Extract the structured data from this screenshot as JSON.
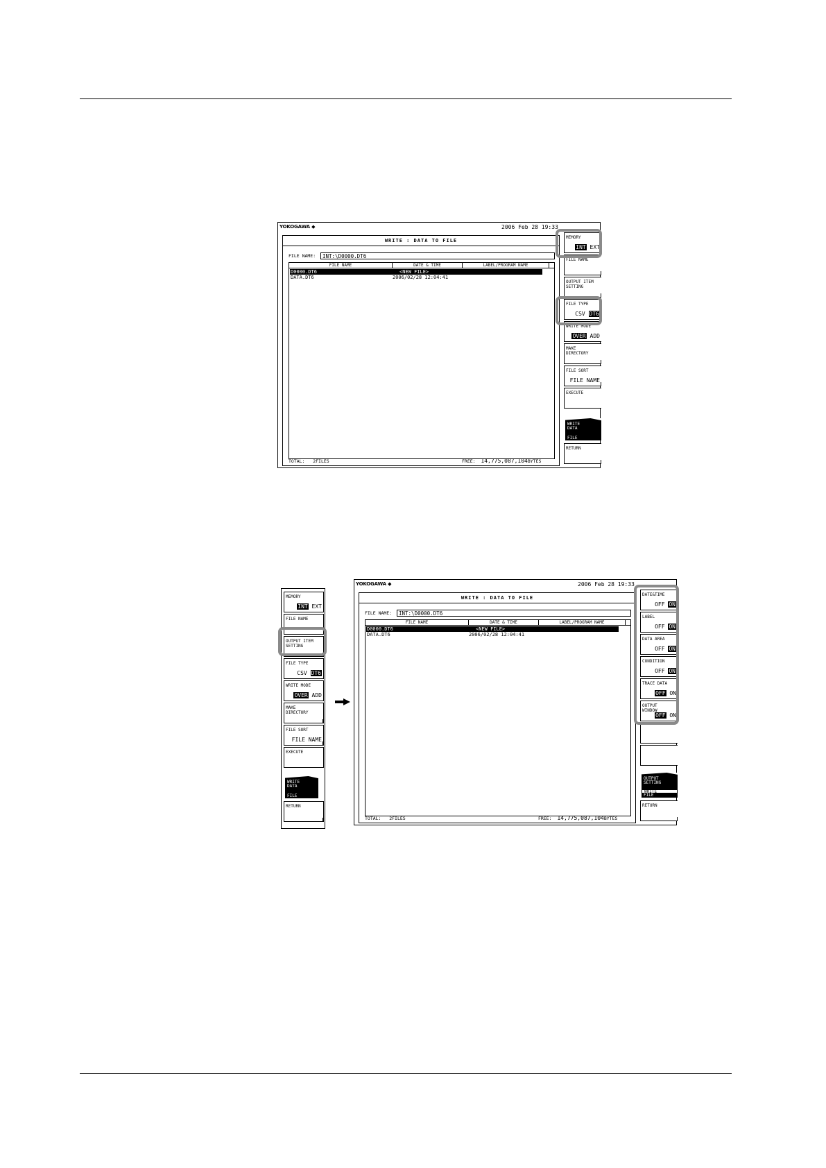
{
  "screen1": {
    "brand": "YOKOGAWA ◆",
    "datetime": "2006 Feb 28 19:33",
    "window_title": "WRITE : DATA TO FILE",
    "file_name_label": "FILE NAME",
    "file_name_value": "INT:\\D0000.DT6",
    "columns": [
      "FILE NAME",
      "DATE & TIME",
      "LABEL/PROGRAM NAME"
    ],
    "rows": [
      {
        "name": "D0000.DT6",
        "date": "<NEW FILE>",
        "selected": true
      },
      {
        "name": "DATA.DT6",
        "date": "2006/02/28 12:04:41",
        "selected": false
      }
    ],
    "total_label": "TOTAL:",
    "total_value": "2FILES",
    "free_label": "FREE:",
    "free_value": "14,775,087,104",
    "free_unit": "BYTES",
    "softkeys": {
      "memory": {
        "label": "MEMORY",
        "opt1": "INT",
        "opt2": "EXT"
      },
      "file_name": {
        "label": "FILE NAME"
      },
      "output_item": {
        "label": "OUTPUT ITEM\nSETTING"
      },
      "file_type": {
        "label": "FILE TYPE",
        "opt1": "CSV",
        "opt2": "DT6"
      },
      "write_mode": {
        "label": "WRITE MODE",
        "opt1": "OVER",
        "opt2": "ADD"
      },
      "make_dir": {
        "label": "MAKE\nDIRECTORY"
      },
      "file_sort": {
        "label": "FILE SORT",
        "value": "FILE NAME"
      },
      "execute": {
        "label": "EXECUTE"
      },
      "menu": {
        "title": "WRITE\nDATA",
        "sub": "FILE"
      },
      "return": {
        "label": "RETURN"
      }
    }
  },
  "left_menu": {
    "memory": {
      "label": "MEMORY",
      "opt1": "INT",
      "opt2": "EXT"
    },
    "file_name": {
      "label": "FILE NAME"
    },
    "output_item": {
      "label": "OUTPUT ITEM\nSETTING"
    },
    "file_type": {
      "label": "FILE TYPE",
      "opt1": "CSV",
      "opt2": "DT6"
    },
    "write_mode": {
      "label": "WRITE MODE",
      "opt1": "OVER",
      "opt2": "ADD"
    },
    "make_dir": {
      "label": "MAKE\nDIRECTORY"
    },
    "file_sort": {
      "label": "FILE SORT",
      "value": "FILE NAME"
    },
    "execute": {
      "label": "EXECUTE"
    },
    "menu": {
      "title": "WRITE\nDATA",
      "sub": "FILE"
    },
    "return": {
      "label": "RETURN"
    }
  },
  "screen2": {
    "brand": "YOKOGAWA ◆",
    "datetime": "2006 Feb 28 19:33",
    "window_title": "WRITE : DATA TO FILE",
    "file_name_label": "FILE NAME",
    "file_name_value": "INT:\\D0000.DT6",
    "columns": [
      "FILE NAME",
      "DATE & TIME",
      "LABEL/PROGRAM NAME"
    ],
    "rows": [
      {
        "name": "D0000.DT6",
        "date": "<NEW FILE>",
        "selected": true
      },
      {
        "name": "DATA.DT6",
        "date": "2006/02/28 12:04:41",
        "selected": false
      }
    ],
    "total_label": "TOTAL:",
    "total_value": "2FILES",
    "free_label": "FREE:",
    "free_value": "14,775,087,104",
    "free_unit": "BYTES",
    "softkeys": {
      "date_time": {
        "label": "DATE&TIME",
        "opt1": "OFF",
        "opt2": "ON"
      },
      "label": {
        "label": "LABEL",
        "opt1": "OFF",
        "opt2": "ON"
      },
      "data_area": {
        "label": "DATA AREA",
        "opt1": "OFF",
        "opt2": "ON"
      },
      "condition": {
        "label": "CONDITION",
        "opt1": "OFF",
        "opt2": "ON"
      },
      "trace_data": {
        "label": "TRACE DATA",
        "opt1": "OFF",
        "opt2": "ON"
      },
      "output_window": {
        "label": "OUTPUT\nWINDOW",
        "opt1": "OFF",
        "opt2": "ON"
      },
      "menu": {
        "title": "OUTPUT\nSETTING",
        "sub1": "WRITE",
        "sub2": "FILE"
      },
      "return": {
        "label": "RETURN"
      }
    }
  },
  "icons": {
    "arrow": "right-arrow-icon"
  }
}
